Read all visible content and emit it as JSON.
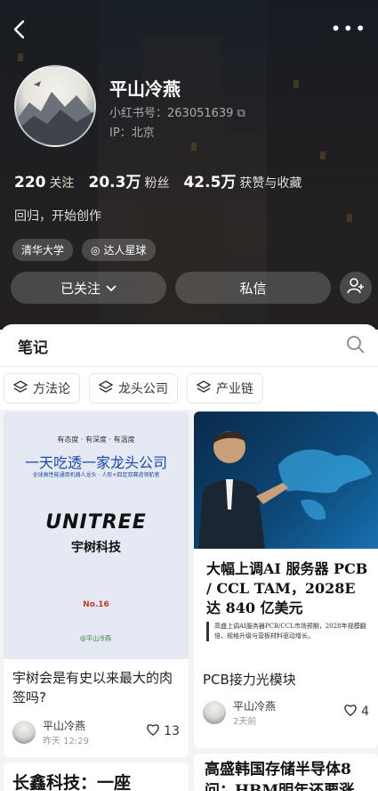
{
  "profile": {
    "name": "平山冷燕",
    "red_id": "小红书号：263051639",
    "ip": "IP：北京",
    "bio": "回归，开始创作",
    "tags": [
      "清华大学",
      "达人星球"
    ]
  },
  "stats": [
    {
      "num": "220",
      "label": "关注"
    },
    {
      "num": "20.3万",
      "label": "粉丝"
    },
    {
      "num": "42.5万",
      "label": "获赞与收藏"
    }
  ],
  "actions": {
    "follow": "已关注",
    "message": "私信"
  },
  "tab": {
    "title": "笔记"
  },
  "categories": [
    "方法论",
    "龙头公司",
    "产业链"
  ],
  "cards": [
    {
      "cover": {
        "sub": "有态度 · 有深度 · 有温度",
        "headline": "一天吃透一家龙头公司",
        "tagline": "全球高性能通用机器人龙头 · 人形+四足双赛道领航者",
        "logo": "UNITREE",
        "logo_cn": "宇树科技",
        "no": "No.16",
        "watermark": "@平山冷燕"
      },
      "title": "宇树会是有史以来最大的肉签吗?",
      "user": "平山冷燕",
      "time": "昨天 12:29",
      "likes": "13"
    },
    {
      "heading": "大幅上调AI 服务器 PCB / CCL TAM，2028E 达 840 亿美元",
      "paragraph": "高盛上调AI服务器PCB/CCL市场预期，2028年规模翻倍，规格升级与营板材料驱动增长。",
      "title": "PCB接力光模块",
      "user": "平山冷燕",
      "time": "2天前",
      "likes": "4"
    },
    {
      "title": "长鑫科技：一座"
    },
    {
      "title": "高盛韩国存储半导体8问：HBM明年还要涨"
    }
  ]
}
